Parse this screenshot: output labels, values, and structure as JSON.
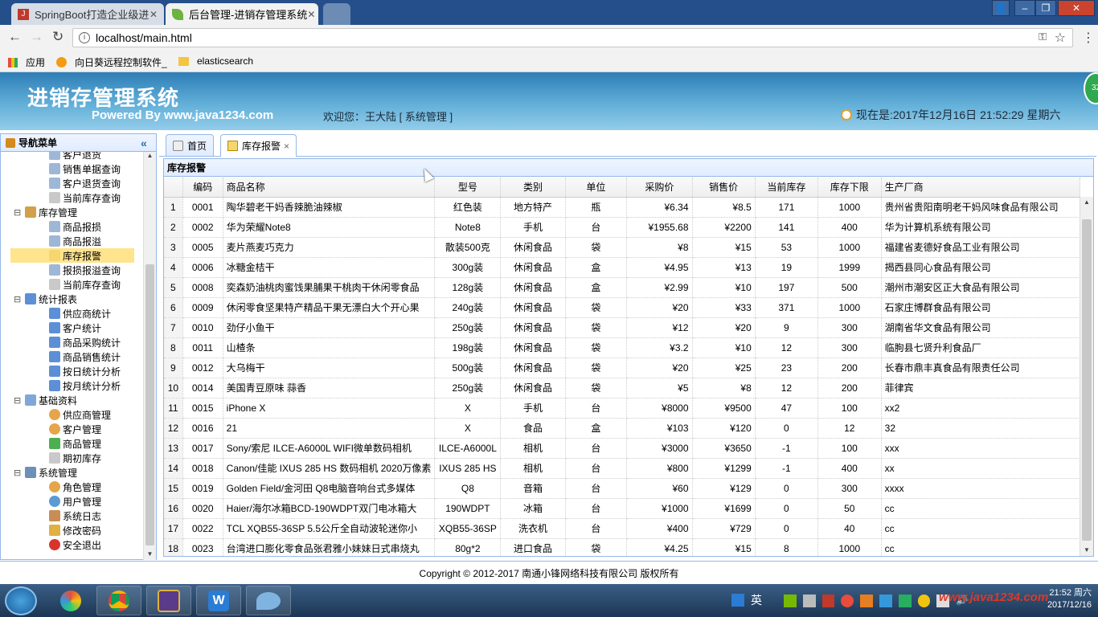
{
  "browser": {
    "tabs": [
      {
        "label": "SpringBoot打造企业级进"
      },
      {
        "label": "后台管理-进销存管理系统"
      }
    ],
    "url": "localhost/main.html",
    "bookmarks": [
      "应用",
      "向日葵远程控制软件_",
      "elasticsearch"
    ],
    "badge": "32"
  },
  "header": {
    "title": "进销存管理系统",
    "powered": "Powered By www.java1234.com",
    "welcome": "欢迎您：王大陆 [ 系统管理 ]",
    "clock": "现在是:2017年12月16日 21:52:29 星期六"
  },
  "sidebar": {
    "title": "导航菜单",
    "collapse_icon": "«",
    "items": [
      {
        "label": "客户退货",
        "level": 2,
        "icon": "doc-search-icon"
      },
      {
        "label": "销售单据查询",
        "level": 2,
        "icon": "doc-search-icon"
      },
      {
        "label": "客户退货查询",
        "level": 2,
        "icon": "doc-search-icon"
      },
      {
        "label": "当前库存查询",
        "level": 2,
        "icon": "doc-icon"
      },
      {
        "label": "库存管理",
        "level": 1,
        "icon": "warehouse-icon"
      },
      {
        "label": "商品报损",
        "level": 2,
        "icon": "doc-search-icon"
      },
      {
        "label": "商品报溢",
        "level": 2,
        "icon": "doc-search-icon"
      },
      {
        "label": "库存报警",
        "level": 2,
        "icon": "alarm-icon",
        "selected": true
      },
      {
        "label": "报损报溢查询",
        "level": 2,
        "icon": "doc-search-icon"
      },
      {
        "label": "当前库存查询",
        "level": 2,
        "icon": "doc-icon"
      },
      {
        "label": "统计报表",
        "level": 1,
        "icon": "chart-icon"
      },
      {
        "label": "供应商统计",
        "level": 2,
        "icon": "chart-icon"
      },
      {
        "label": "客户统计",
        "level": 2,
        "icon": "chart-icon"
      },
      {
        "label": "商品采购统计",
        "level": 2,
        "icon": "chart-icon"
      },
      {
        "label": "商品销售统计",
        "level": 2,
        "icon": "chart-icon"
      },
      {
        "label": "按日统计分析",
        "level": 2,
        "icon": "chart-icon"
      },
      {
        "label": "按月统计分析",
        "level": 2,
        "icon": "chart-icon"
      },
      {
        "label": "基础资料",
        "level": 1,
        "icon": "base-icon"
      },
      {
        "label": "供应商管理",
        "level": 2,
        "icon": "user-icon"
      },
      {
        "label": "客户管理",
        "level": 2,
        "icon": "user-icon"
      },
      {
        "label": "商品管理",
        "level": 2,
        "icon": "tree-icon"
      },
      {
        "label": "期初库存",
        "level": 2,
        "icon": "doc-icon"
      },
      {
        "label": "系统管理",
        "level": 1,
        "icon": "computer-icon"
      },
      {
        "label": "角色管理",
        "level": 2,
        "icon": "user-icon"
      },
      {
        "label": "用户管理",
        "level": 2,
        "icon": "users-icon"
      },
      {
        "label": "系统日志",
        "level": 2,
        "icon": "log-icon"
      },
      {
        "label": "修改密码",
        "level": 2,
        "icon": "lock-icon"
      },
      {
        "label": "安全退出",
        "level": 2,
        "icon": "exit-icon"
      }
    ]
  },
  "tabs": [
    {
      "label": "首页"
    },
    {
      "label": "库存报警",
      "closable": "×"
    }
  ],
  "panel": {
    "title": "库存报警",
    "columns": [
      "编码",
      "商品名称",
      "型号",
      "类别",
      "单位",
      "采购价",
      "销售价",
      "当前库存",
      "库存下限",
      "生产厂商"
    ],
    "rows": [
      [
        "1",
        "0001",
        "陶华碧老干妈香辣脆油辣椒",
        "红色装",
        "地方特产",
        "瓶",
        "¥6.34",
        "¥8.5",
        "171",
        "1000",
        "贵州省贵阳南明老干妈风味食品有限公司"
      ],
      [
        "2",
        "0002",
        "华为荣耀Note8",
        "Note8",
        "手机",
        "台",
        "¥1955.68",
        "¥2200",
        "141",
        "400",
        "华为计算机系统有限公司"
      ],
      [
        "3",
        "0005",
        "麦片燕麦巧克力",
        "散装500克",
        "休闲食品",
        "袋",
        "¥8",
        "¥15",
        "53",
        "1000",
        "福建省麦德好食品工业有限公司"
      ],
      [
        "4",
        "0006",
        "冰糖金桔干",
        "300g装",
        "休闲食品",
        "盒",
        "¥4.95",
        "¥13",
        "19",
        "1999",
        "揭西县同心食品有限公司"
      ],
      [
        "5",
        "0008",
        "奕森奶油桃肉蜜饯果脯果干桃肉干休闲零食品",
        "128g装",
        "休闲食品",
        "盒",
        "¥2.99",
        "¥10",
        "197",
        "500",
        "潮州市潮安区正大食品有限公司"
      ],
      [
        "6",
        "0009",
        "休闲零食坚果特产精品干果无漂白大个开心果",
        "240g装",
        "休闲食品",
        "袋",
        "¥20",
        "¥33",
        "371",
        "1000",
        "石家庄博群食品有限公司"
      ],
      [
        "7",
        "0010",
        "劲仔小鱼干",
        "250g装",
        "休闲食品",
        "袋",
        "¥12",
        "¥20",
        "9",
        "300",
        "湖南省华文食品有限公司"
      ],
      [
        "8",
        "0011",
        "山楂条",
        "198g装",
        "休闲食品",
        "袋",
        "¥3.2",
        "¥10",
        "12",
        "300",
        "临朐县七贤升利食品厂"
      ],
      [
        "9",
        "0012",
        "大乌梅干",
        "500g装",
        "休闲食品",
        "袋",
        "¥20",
        "¥25",
        "23",
        "200",
        "长春市鼎丰真食品有限责任公司"
      ],
      [
        "10",
        "0014",
        "美国青豆原味 蒜香",
        "250g装",
        "休闲食品",
        "袋",
        "¥5",
        "¥8",
        "12",
        "200",
        "菲律宾"
      ],
      [
        "11",
        "0015",
        "iPhone X",
        "X",
        "手机",
        "台",
        "¥8000",
        "¥9500",
        "47",
        "100",
        "xx2"
      ],
      [
        "12",
        "0016",
        "21",
        "X",
        "食品",
        "盒",
        "¥103",
        "¥120",
        "0",
        "12",
        "32"
      ],
      [
        "13",
        "0017",
        "Sony/索尼 ILCE-A6000L WIFI微单数码相机",
        "ILCE-A6000L",
        "相机",
        "台",
        "¥3000",
        "¥3650",
        "-1",
        "100",
        "xxx"
      ],
      [
        "14",
        "0018",
        "Canon/佳能 IXUS 285 HS 数码相机 2020万像素",
        "IXUS 285 HS",
        "相机",
        "台",
        "¥800",
        "¥1299",
        "-1",
        "400",
        "xx"
      ],
      [
        "15",
        "0019",
        "Golden Field/金河田 Q8电脑音响台式多媒体",
        "Q8",
        "音箱",
        "台",
        "¥60",
        "¥129",
        "0",
        "300",
        "xxxx"
      ],
      [
        "16",
        "0020",
        "Haier/海尔冰箱BCD-190WDPT双门电冰箱大",
        "190WDPT",
        "冰箱",
        "台",
        "¥1000",
        "¥1699",
        "0",
        "50",
        "cc"
      ],
      [
        "17",
        "0022",
        "TCL XQB55-36SP 5.5公斤全自动波轮迷你小",
        "XQB55-36SP",
        "洗衣机",
        "台",
        "¥400",
        "¥729",
        "0",
        "40",
        "cc"
      ],
      [
        "18",
        "0023",
        "台湾进口膨化零食品张君雅小妹妹日式串烧丸",
        "80g*2",
        "进口食品",
        "袋",
        "¥4.25",
        "¥15",
        "8",
        "1000",
        "cc"
      ]
    ]
  },
  "footer": {
    "copyright": "Copyright © 2012-2017 南通小锋网络科技有限公司 版权所有"
  },
  "taskbar": {
    "ime": "英",
    "time": "21:52 周六",
    "date": "2017/12/16",
    "watermark": "www.java1234.com"
  }
}
